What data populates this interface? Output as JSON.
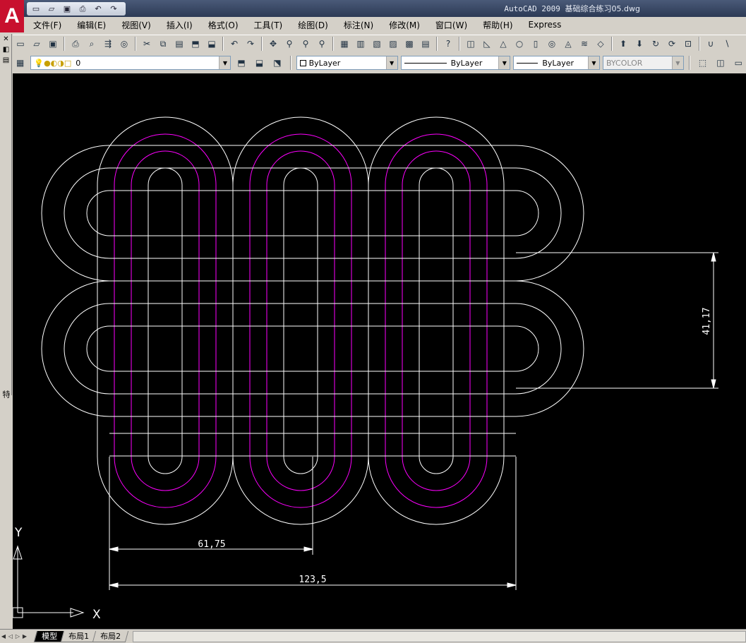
{
  "app": {
    "name_version": "AutoCAD 2009",
    "document": "基础综合练习05.dwg",
    "logo_letter": "A"
  },
  "quick_access": [
    "new-icon",
    "open-icon",
    "save-icon",
    "print-icon",
    "undo-icon",
    "redo-icon"
  ],
  "menu": [
    "文件(F)",
    "编辑(E)",
    "视图(V)",
    "插入(I)",
    "格式(O)",
    "工具(T)",
    "绘图(D)",
    "标注(N)",
    "修改(M)",
    "窗口(W)",
    "帮助(H)",
    "Express"
  ],
  "layers": {
    "current": "0",
    "color": "ByLayer",
    "linetype": "ByLayer",
    "lineweight": "ByLayer",
    "plotstyle": "BYCOLOR"
  },
  "palette": {
    "label": "特性"
  },
  "dimensions": {
    "vertical": "41,17",
    "horizontal_half": "61,75",
    "horizontal_full": "123,5"
  },
  "ucs": {
    "x_label": "X",
    "y_label": "Y"
  },
  "layout_tabs": [
    "模型",
    "布局1",
    "布局2"
  ],
  "colors": {
    "background": "#000000",
    "outline": "#ffffff",
    "centerline": "#ff00ff"
  }
}
